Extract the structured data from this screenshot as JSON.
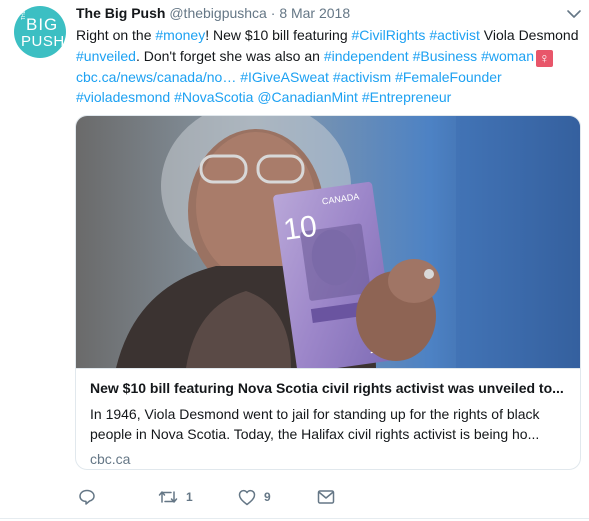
{
  "avatar": {
    "small_text": "THE",
    "line1": "BIG",
    "line2": "PUSH"
  },
  "tweet": {
    "name": "The Big Push",
    "handle": "@thebigpushca",
    "separator": "·",
    "date": "8 Mar 2018",
    "lines": [
      [
        {
          "text": "Right on the ",
          "link": false
        },
        {
          "text": "#money",
          "link": true
        },
        {
          "text": "! New $10 bill featuring ",
          "link": false
        },
        {
          "text": "#CivilRights",
          "link": true
        },
        {
          "text": " ",
          "link": false
        },
        {
          "text": "#activist",
          "link": true
        },
        {
          "text": " Viola Desmond",
          "link": false
        }
      ],
      [
        {
          "text": "#unveiled",
          "link": true
        },
        {
          "text": ". Don't forget she was also an ",
          "link": false
        },
        {
          "text": "#independent",
          "link": true
        },
        {
          "text": " ",
          "link": false
        },
        {
          "text": "#Business",
          "link": true
        },
        {
          "text": " ",
          "link": false
        },
        {
          "text": "#woman",
          "link": true
        }
      ],
      [
        {
          "text": "cbc.ca/news/canada/no…",
          "link": true
        },
        {
          "text": " ",
          "link": false
        },
        {
          "text": "#IGiveASweat",
          "link": true
        },
        {
          "text": " ",
          "link": false
        },
        {
          "text": "#activism",
          "link": true
        },
        {
          "text": " ",
          "link": false
        },
        {
          "text": "#FemaleFounder",
          "link": true
        }
      ],
      [
        {
          "text": "#violadesmond",
          "link": true
        },
        {
          "text": " ",
          "link": false
        },
        {
          "text": "#NovaScotia",
          "link": true
        },
        {
          "text": " ",
          "link": false
        },
        {
          "text": "@CanadianMint",
          "link": true
        },
        {
          "text": " ",
          "link": false
        },
        {
          "text": "#Entrepreneur",
          "link": true
        }
      ]
    ],
    "emoji": "♀"
  },
  "card": {
    "banknote_country": "CANADA",
    "banknote_value": "10",
    "title": "New $10 bill featuring Nova Scotia civil rights activist was unveiled to...",
    "description_line1": "In 1946, Viola Desmond went to jail for standing up for the rights of black",
    "description_line2": "people in Nova Scotia. Today, the Halifax civil rights activist is being ho...",
    "domain": "cbc.ca"
  },
  "actions": {
    "reply_icon": "reply-icon",
    "retweet_icon": "retweet-icon",
    "retweet_count": "1",
    "like_icon": "heart-icon",
    "like_count": "9",
    "dm_icon": "envelope-icon"
  },
  "colors": {
    "link": "#1da1f2",
    "secondary": "#657786",
    "avatar_bg": "#3cbfc3",
    "border": "#e1e8ed"
  }
}
